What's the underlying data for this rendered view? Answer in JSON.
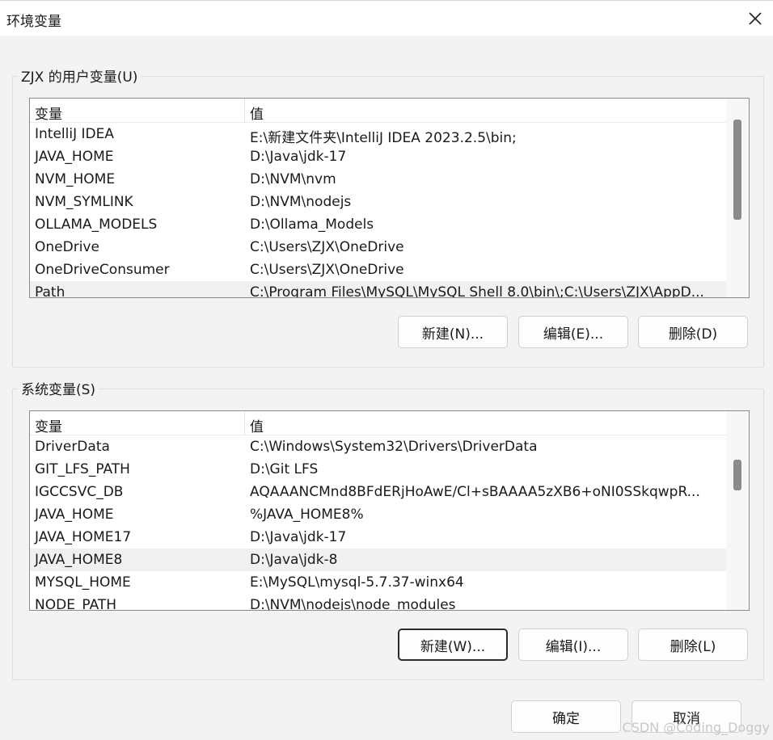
{
  "window": {
    "title": "环境变量",
    "close_icon": "close-icon"
  },
  "user_vars": {
    "group_label": "ZJX 的用户变量(U)",
    "columns": [
      "变量",
      "值"
    ],
    "rows": [
      [
        "IntelliJ IDEA",
        "E:\\新建文件夹\\IntelliJ IDEA 2023.2.5\\bin;"
      ],
      [
        "JAVA_HOME",
        "D:\\Java\\jdk-17"
      ],
      [
        "NVM_HOME",
        "D:\\NVM\\nvm"
      ],
      [
        "NVM_SYMLINK",
        "D:\\NVM\\nodejs"
      ],
      [
        "OLLAMA_MODELS",
        "D:\\Ollama_Models"
      ],
      [
        "OneDrive",
        "C:\\Users\\ZJX\\OneDrive"
      ],
      [
        "OneDriveConsumer",
        "C:\\Users\\ZJX\\OneDrive"
      ],
      [
        "Path",
        "C:\\Program Files\\MySQL\\MySQL Shell 8.0\\bin\\;C:\\Users\\ZJX\\AppD..."
      ]
    ],
    "selected_row": 7,
    "buttons": {
      "new": "新建(N)...",
      "edit": "编辑(E)...",
      "delete": "删除(D)"
    }
  },
  "system_vars": {
    "group_label": "系统变量(S)",
    "columns": [
      "变量",
      "值"
    ],
    "rows": [
      [
        "DriverData",
        "C:\\Windows\\System32\\Drivers\\DriverData"
      ],
      [
        "GIT_LFS_PATH",
        "D:\\Git LFS"
      ],
      [
        "IGCCSVC_DB",
        "AQAAANCMnd8BFdERjHoAwE/Cl+sBAAAA5zXB6+oNI0SSkqwpR..."
      ],
      [
        "JAVA_HOME",
        "%JAVA_HOME8%"
      ],
      [
        "JAVA_HOME17",
        "D:\\Java\\jdk-17"
      ],
      [
        "JAVA_HOME8",
        "D:\\Java\\jdk-8"
      ],
      [
        "MYSQL_HOME",
        "E:\\MySQL\\mysql-5.7.37-winx64"
      ],
      [
        "NODE_PATH",
        "D:\\NVM\\nodejs\\node_modules"
      ]
    ],
    "selected_row": 5,
    "buttons": {
      "new": "新建(W)...",
      "edit": "编辑(I)...",
      "delete": "删除(L)"
    }
  },
  "footer": {
    "ok": "确定",
    "cancel": "取消"
  },
  "watermark": "CSDN @Coding_Doggy"
}
